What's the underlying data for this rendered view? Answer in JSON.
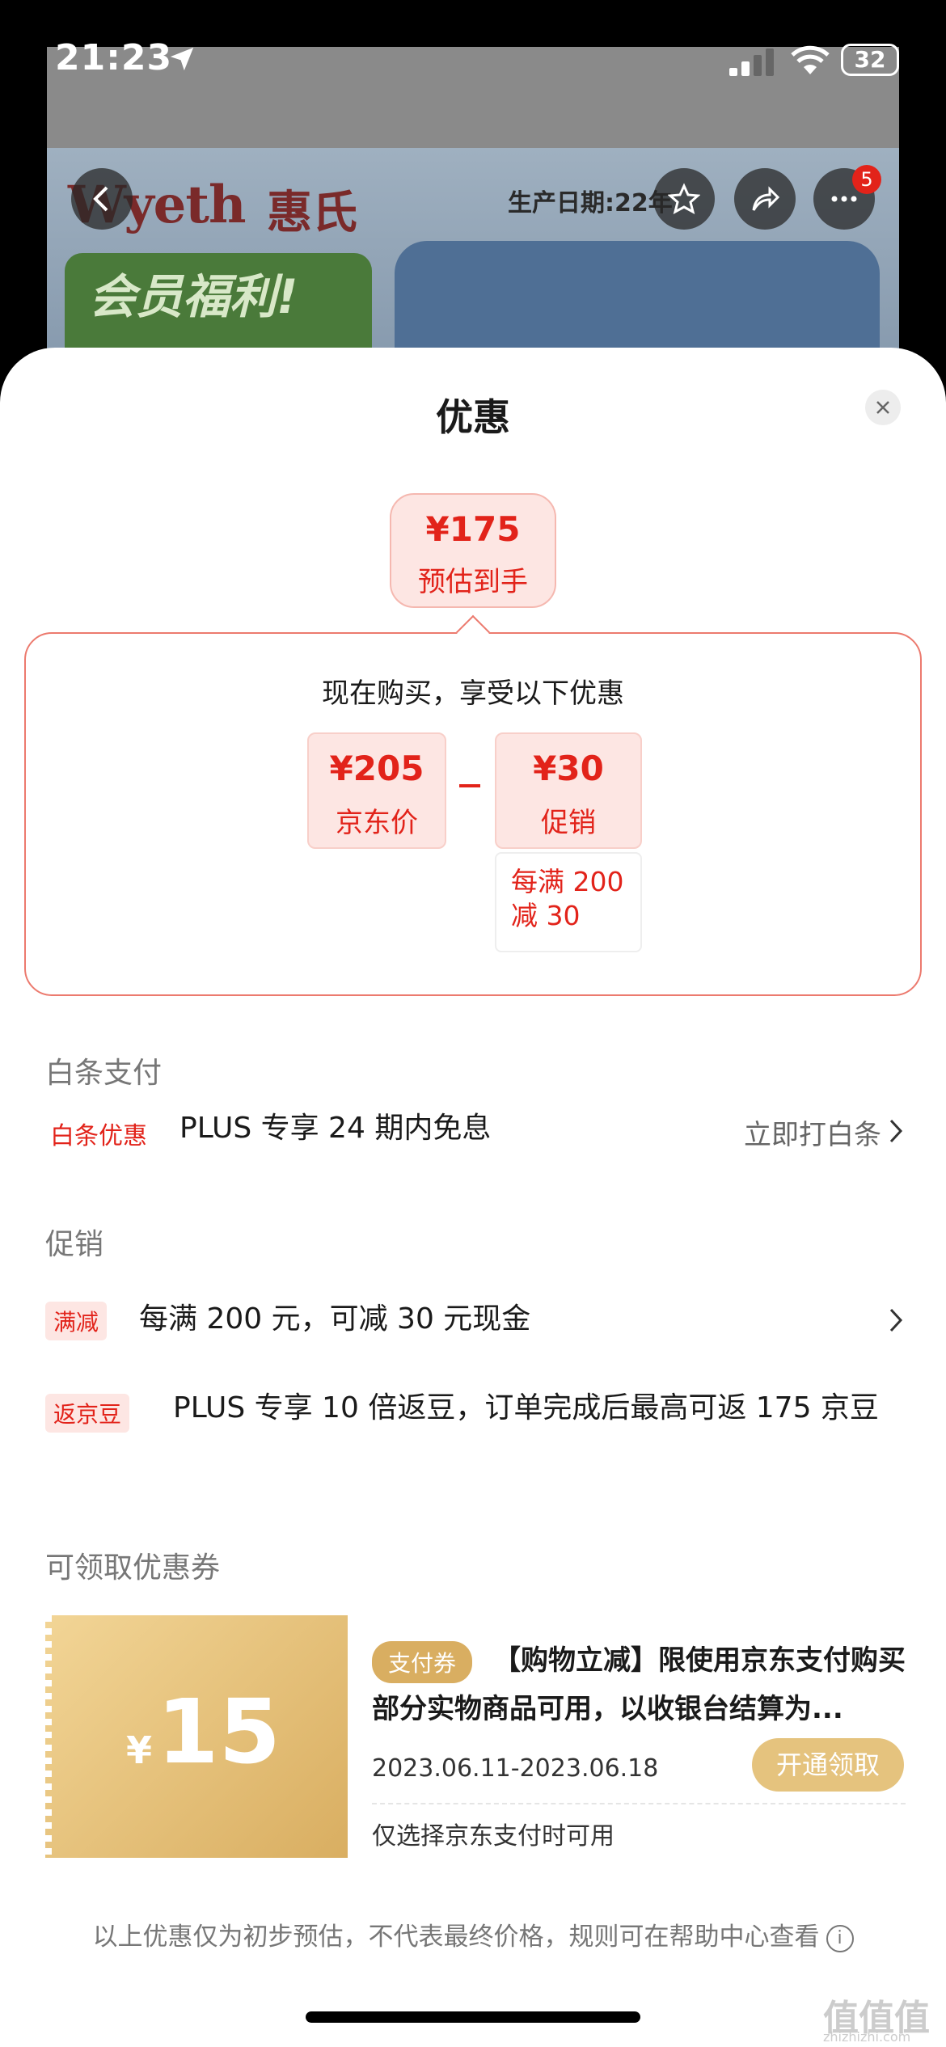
{
  "status_bar": {
    "time": "21:23",
    "battery": "32"
  },
  "background": {
    "brand_en": "Wyeth",
    "brand_cn": "惠氏",
    "production_date": "生产日期:22年",
    "promo_banner": "会员福利!",
    "more_badge": "5"
  },
  "sheet": {
    "title": "优惠",
    "estimate": {
      "price": "¥175",
      "label": "预估到手"
    },
    "calc": {
      "title": "现在购买，享受以下优惠",
      "jd_price": {
        "price": "¥205",
        "label": "京东价"
      },
      "promo": {
        "price": "¥30",
        "label": "促销"
      },
      "promo_detail": "每满 200 减 30"
    },
    "baitiao": {
      "section": "白条支付",
      "tag": "白条优惠",
      "text": "PLUS 专享 24 期内免息",
      "action": "立即打白条"
    },
    "promotions": {
      "section": "促销",
      "items": [
        {
          "tag": "满减",
          "text": "每满 200 元，可减 30 元现金"
        },
        {
          "tag": "返京豆",
          "text": "PLUS 专享 10 倍返豆，订单完成后最高可返 175 京豆"
        }
      ]
    },
    "coupons": {
      "section": "可领取优惠券",
      "coupon": {
        "currency": "¥",
        "amount": "15",
        "tag": "支付券",
        "desc": "【购物立减】限使用京东支付购买部分实物商品可用，以收银台结算为...",
        "date": "2023.06.11-2023.06.18",
        "button": "开通领取",
        "note": "仅选择京东支付时可用"
      }
    },
    "footer": "以上优惠仅为初步预估，不代表最终价格，规则可在帮助中心查看",
    "info_glyph": "i",
    "watermark": "值值值",
    "watermark_sub": "zhizhizhi.com"
  }
}
